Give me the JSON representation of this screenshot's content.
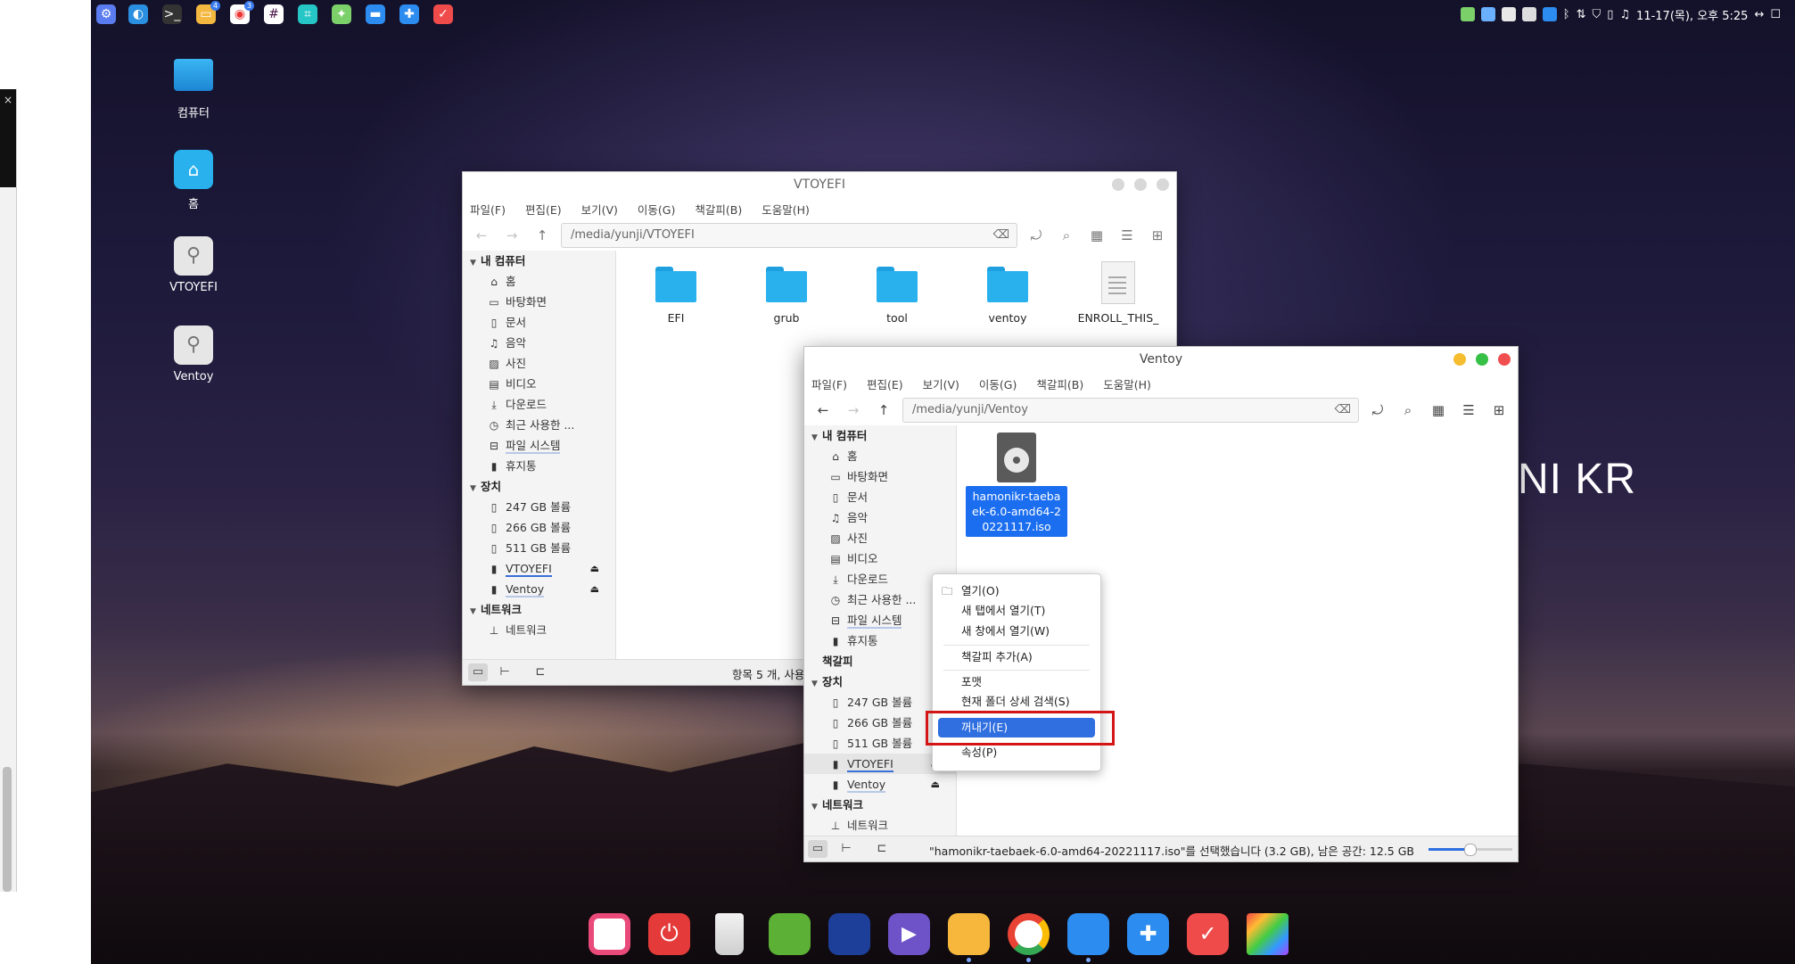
{
  "top_panel": {
    "app_icons": [
      "settings-icon",
      "browser-icon",
      "terminal-icon",
      "folder-icon",
      "chrome-icon",
      "slack-icon",
      "screenshot-icon",
      "rainbow-icon",
      "software-center-icon",
      "extensions-icon",
      "todo-icon"
    ],
    "badges": {
      "folder": "4",
      "chrome": "3"
    },
    "datetime": "11-17(목), 오후 5:25"
  },
  "left_edge": {
    "close": "×"
  },
  "desktop": {
    "icons": [
      {
        "label": "컴퓨터"
      },
      {
        "label": "홈"
      },
      {
        "label": "VTOYEFI"
      },
      {
        "label": "Ventoy"
      }
    ],
    "watermark": "NI KR"
  },
  "window_vtoyefi": {
    "title": "VTOYEFI",
    "menu": [
      "파일(F)",
      "편집(E)",
      "보기(V)",
      "이동(G)",
      "책갈피(B)",
      "도움말(H)"
    ],
    "path": "/media/yunji/VTOYEFI",
    "sidebar": {
      "my_computer": "내 컴퓨터",
      "places": [
        "홈",
        "바탕화면",
        "문서",
        "음악",
        "사진",
        "비디오",
        "다운로드",
        "최근 사용한 ...",
        "파일 시스템",
        "휴지통"
      ],
      "devices": "장치",
      "device_items": [
        "247 GB 볼륨",
        "266 GB 볼륨",
        "511 GB 볼륨",
        "VTOYEFI",
        "Ventoy"
      ],
      "network": "네트워크",
      "network_items": [
        "네트워크"
      ]
    },
    "files": [
      "EFI",
      "grub",
      "tool",
      "ventoy",
      "ENROLL_THIS_"
    ],
    "status": "항목 5 개, 사용"
  },
  "window_ventoy": {
    "title": "Ventoy",
    "menu": [
      "파일(F)",
      "편집(E)",
      "보기(V)",
      "이동(G)",
      "책갈피(B)",
      "도움말(H)"
    ],
    "path": "/media/yunji/Ventoy",
    "sidebar": {
      "my_computer": "내 컴퓨터",
      "places": [
        "홈",
        "바탕화면",
        "문서",
        "음악",
        "사진",
        "비디오",
        "다운로드",
        "최근 사용한 ...",
        "파일 시스템",
        "휴지통"
      ],
      "bookmarks": "책갈피",
      "devices": "장치",
      "device_items": [
        "247 GB 볼륨",
        "266 GB 볼륨",
        "511 GB 볼륨",
        "VTOYEFI",
        "Ventoy"
      ],
      "network": "네트워크",
      "network_items": [
        "네트워크"
      ]
    },
    "selected_file": "hamonikr-taebaek-6.0-amd64-20221117.iso",
    "status": "\"hamonikr-taebaek-6.0-amd64-20221117.iso\"를 선택했습니다 (3.2 GB), 남은 공간: 12.5 GB"
  },
  "context_menu": {
    "items": [
      "열기(O)",
      "새 탭에서 열기(T)",
      "새 창에서 열기(W)",
      "책갈피 추가(A)",
      "포맷",
      "현재 폴더 상세 검색(S)",
      "꺼내기(E)",
      "속성(P)"
    ],
    "highlighted": "꺼내기(E)"
  },
  "dock": {
    "apps": [
      "video-app-icon",
      "power-icon",
      "trash-icon",
      "libreoffice-calc-icon",
      "browser-icon",
      "media-player-icon",
      "files-icon",
      "chrome-icon",
      "software-center-icon",
      "extensions-icon",
      "todo-icon",
      "rainbow-icon"
    ]
  },
  "colors": {
    "accent": "#2f6fe0",
    "highlight_box": "#d41515",
    "folder": "#29b1ee",
    "close_red": "#f14f4f",
    "min_yellow": "#f5bd2f",
    "max_green": "#37c046"
  }
}
